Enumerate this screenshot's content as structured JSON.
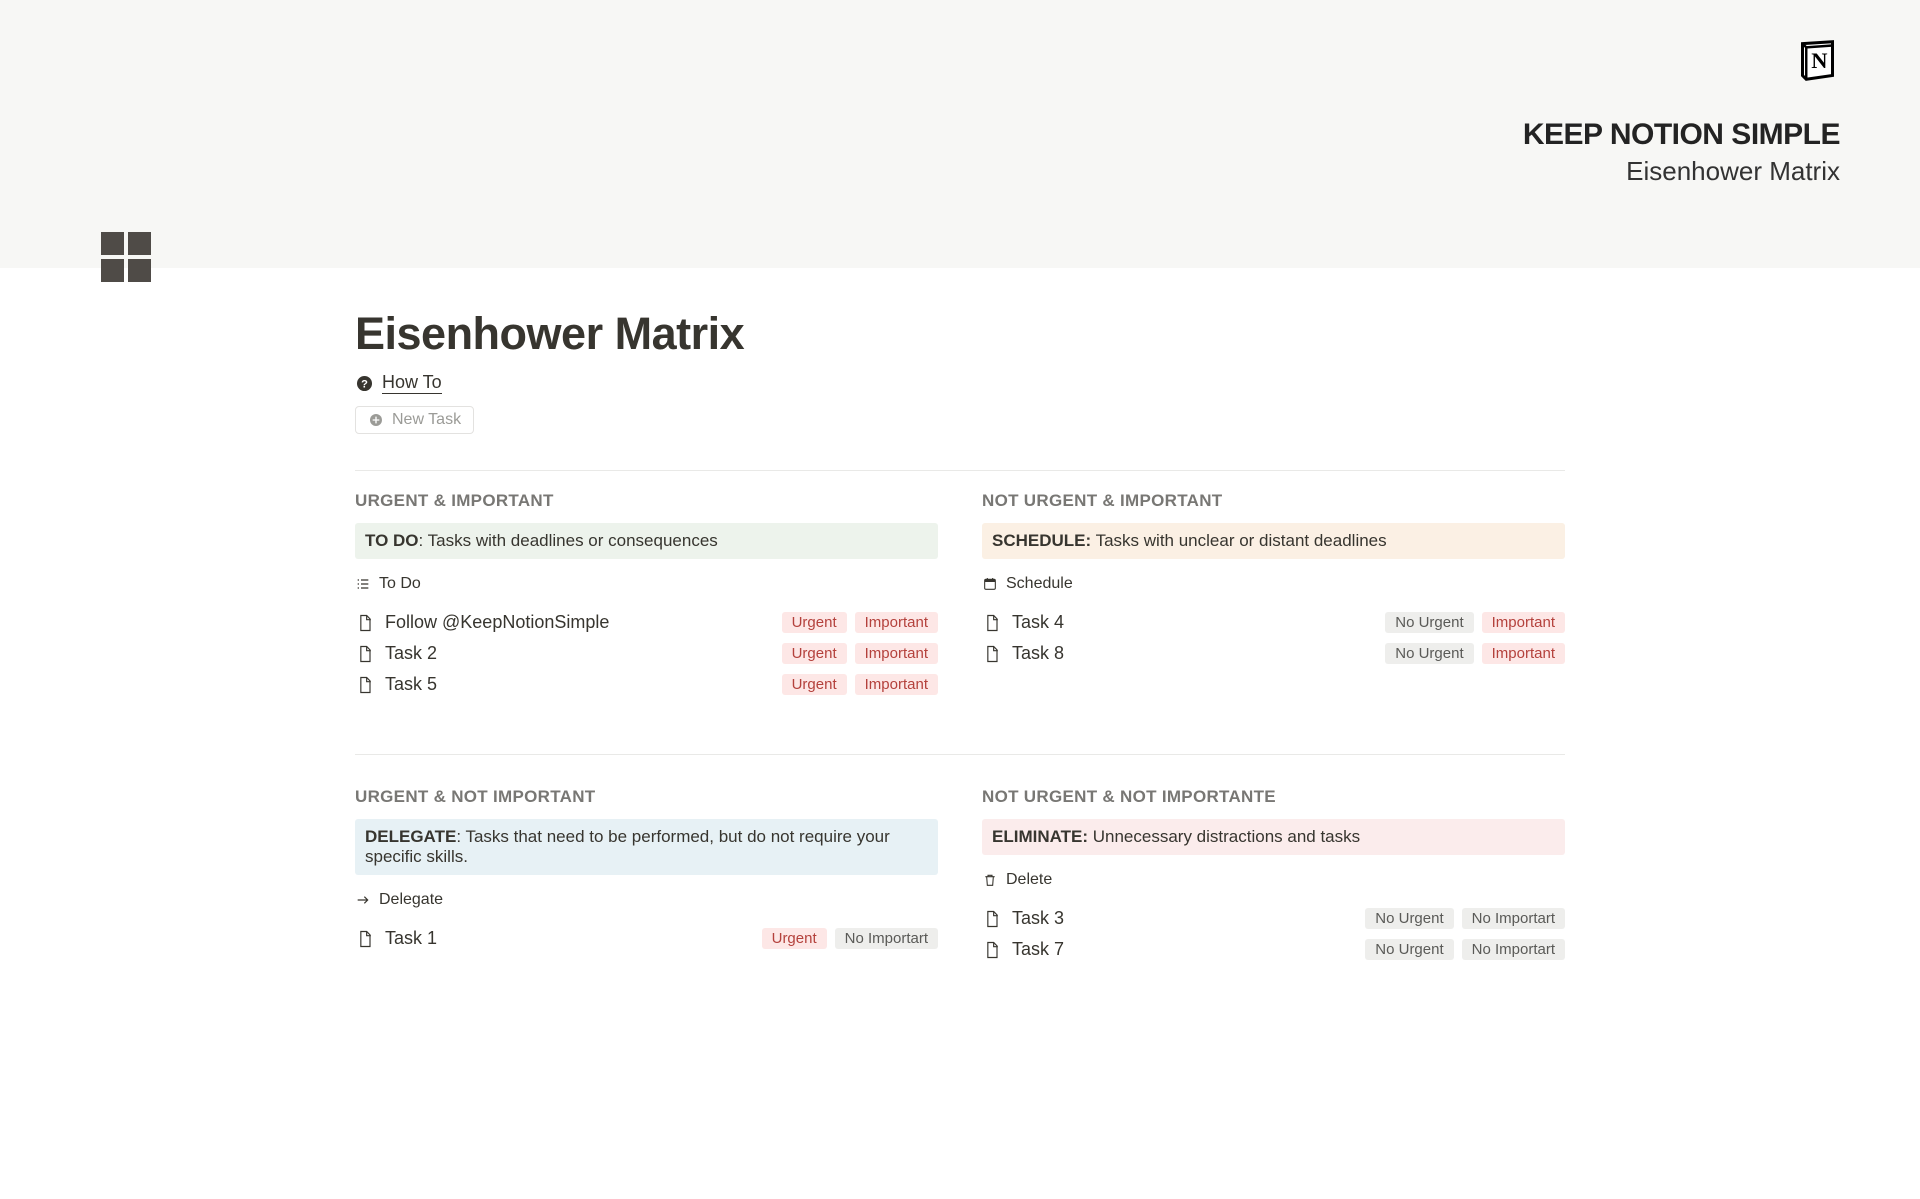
{
  "hero": {
    "tagline": "KEEP NOTION SIMPLE",
    "subtitle": "Eisenhower Matrix"
  },
  "title": "Eisenhower Matrix",
  "links": {
    "howto": "How To",
    "newtask": "New Task"
  },
  "quad1": {
    "header": "URGENT & IMPORTANT",
    "callout_action": "TO DO",
    "callout_rest": ": Tasks with deadlines or consequences",
    "view": "To Do",
    "items": [
      {
        "title": "Follow @KeepNotionSimple",
        "tags": [
          "Urgent",
          "Important"
        ]
      },
      {
        "title": "Task 2",
        "tags": [
          "Urgent",
          "Important"
        ]
      },
      {
        "title": "Task 5",
        "tags": [
          "Urgent",
          "Important"
        ]
      }
    ]
  },
  "quad2": {
    "header": "NOT URGENT & IMPORTANT",
    "callout_action": "SCHEDULE:",
    "callout_rest": " Tasks with unclear or distant deadlines",
    "view": "Schedule",
    "items": [
      {
        "title": "Task 4",
        "tags": [
          "No Urgent",
          "Important"
        ]
      },
      {
        "title": "Task 8",
        "tags": [
          "No Urgent",
          "Important"
        ]
      }
    ]
  },
  "quad3": {
    "header": "URGENT & NOT IMPORTANT",
    "callout_action": "DELEGATE",
    "callout_rest": ": Tasks that need to be performed, but do not require your specific skills.",
    "view": "Delegate",
    "items": [
      {
        "title": "Task 1",
        "tags": [
          "Urgent",
          "No Importart"
        ]
      }
    ]
  },
  "quad4": {
    "header": "NOT URGENT & NOT IMPORTANTE",
    "callout_action": "ELIMINATE:",
    "callout_rest": " Unnecessary distractions and tasks",
    "view": "Delete",
    "items": [
      {
        "title": "Task 3",
        "tags": [
          "No Urgent",
          "No Importart"
        ]
      },
      {
        "title": "Task 7",
        "tags": [
          "No Urgent",
          "No Importart"
        ]
      }
    ]
  }
}
